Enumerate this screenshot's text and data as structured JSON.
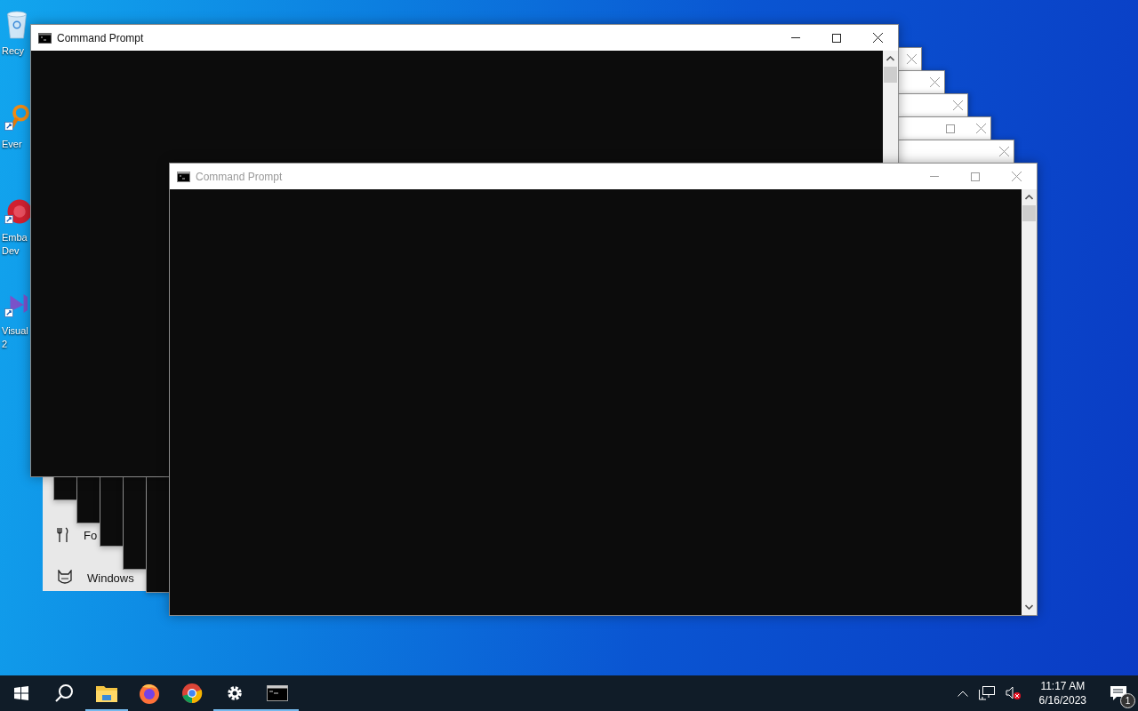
{
  "desktop_icons": [
    {
      "kind": "recycle-bin",
      "label": [
        "Recy"
      ]
    },
    {
      "kind": "everything",
      "label": [
        "Ever"
      ]
    },
    {
      "kind": "embarcadero",
      "label": [
        "Emba",
        "Dev"
      ]
    },
    {
      "kind": "visual-studio",
      "label": [
        "Visual",
        "2"
      ]
    }
  ],
  "background_app": {
    "items": [
      {
        "kind": "utensils",
        "label": "Fo"
      },
      {
        "kind": "cat",
        "label": "Windows"
      }
    ]
  },
  "background_windows": [
    {
      "kind": "console",
      "maximize": false
    },
    {
      "kind": "console",
      "maximize": false
    },
    {
      "kind": "console",
      "maximize": false
    },
    {
      "kind": "console",
      "maximize": true
    },
    {
      "kind": "console",
      "maximize": false
    }
  ],
  "windows": [
    {
      "title": "Command Prompt",
      "active": true
    },
    {
      "title": "Command Prompt",
      "active": false
    }
  ],
  "taskbar": {
    "apps": [
      {
        "kind": "start",
        "running": false
      },
      {
        "kind": "search",
        "running": false
      },
      {
        "kind": "explorer",
        "running": true
      },
      {
        "kind": "firefox",
        "running": false
      },
      {
        "kind": "chrome",
        "running": false
      },
      {
        "kind": "settings",
        "running": true
      },
      {
        "kind": "console",
        "running": true
      }
    ],
    "time": "11:17 AM",
    "date": "6/16/2023",
    "notification_count": "1"
  }
}
